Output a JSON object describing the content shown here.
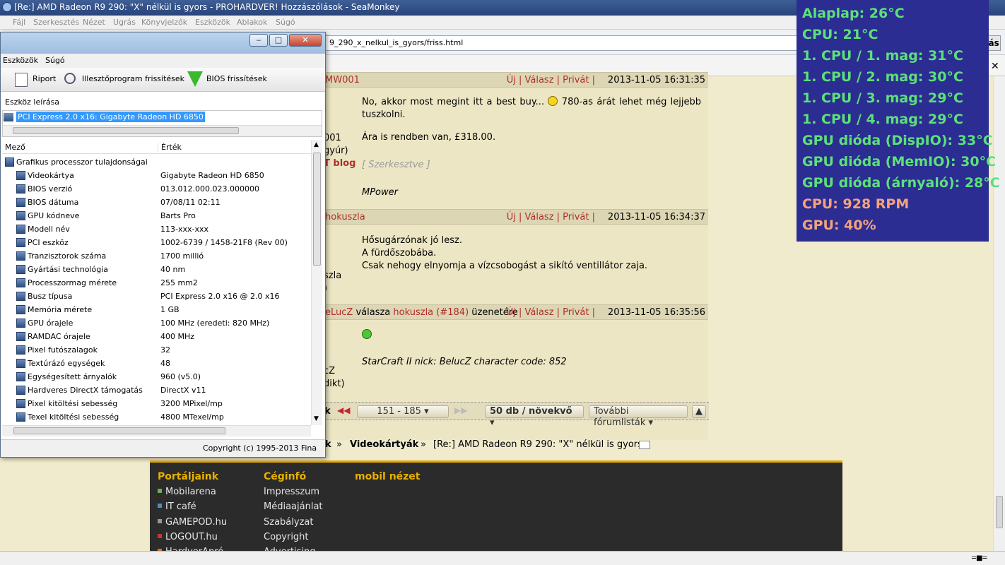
{
  "window": {
    "title": "[Re:] AMD Radeon R9 290: \"X\" nélkül is gyors - PROHARDVER! Hozzászólások - SeaMonkey",
    "menu": [
      "Fájl",
      "Szerkesztés",
      "Nézet",
      "Ugrás",
      "Könyvjelzők",
      "Eszközök",
      "Ablakok",
      "Súgó"
    ],
    "url": "9_290_x_nelkul_is_gyors/friss.html",
    "go_label": "Ugrás"
  },
  "posts": [
    {
      "user_fragment": "MW001",
      "actions": "Új | Válasz | Privát |",
      "date": "2013-11-05 16:31:35",
      "left_lines": [
        "001",
        "gyúr)",
        "T blog"
      ],
      "text": [
        "No, akkor most megint itt a best buy...",
        "780-as árát lehet még lejjebb tuszkolni.",
        "Ára is rendben van, £318.00."
      ],
      "edited": "[ Szerkesztve ]",
      "signature": "MPower"
    },
    {
      "user_fragment": "hokuszla",
      "actions": "Új | Válasz | Privát |",
      "date": "2013-11-05 16:34:37",
      "left_lines": [
        "szla",
        ")"
      ],
      "text": [
        "Hősugárzónak jó lesz.",
        "A fürdőszobába.",
        "Csak nehogy elnyomja a vízcsobogást a sikító ventillátor zaja."
      ]
    },
    {
      "user_fragment": "eLucZ",
      "reply_word": "válasza",
      "reply_to": "hokuszla",
      "reply_num": "(#184)",
      "reply_suffix": "üzenetére",
      "actions": "Új | Válasz | Privát |",
      "date": "2013-11-05 16:35:56",
      "left_lines": [
        "cZ",
        "dikt)"
      ],
      "signature": "StarCraft II nick: BelucZ character code: 852"
    }
  ],
  "pager": {
    "range": "151 - 185",
    "per_page": "50 db / növekvő",
    "more": "További fórumlisták",
    "left_fragment": "k"
  },
  "breadcrumb": {
    "prefix": "k",
    "sep": "»",
    "category": "Videokártyák",
    "topic": "[Re:] AMD Radeon R9 290: \"X\" nélkül is gyors"
  },
  "footer": {
    "col1_title": "Portáljaink",
    "col1": [
      {
        "label": "Mobilarena",
        "color": "#6ab04c"
      },
      {
        "label": "IT café",
        "color": "#4a90c2"
      },
      {
        "label": "GAMEPOD.hu",
        "color": "#999999"
      },
      {
        "label": "LOGOUT.hu",
        "color": "#cc3333"
      },
      {
        "label": "HardverApró",
        "color": "#e07020"
      }
    ],
    "col2_title": "Céginfó",
    "col2": [
      "Impresszum",
      "Médiaajánlat",
      "Szabályzat",
      "Copyright",
      "Advertising"
    ],
    "col3_title": "mobil nézet"
  },
  "tool": {
    "menu": [
      "Eszközök",
      "Súgó"
    ],
    "toolbar": [
      "Riport",
      "Illesztőprogram frissítések",
      "BIOS frissítések"
    ],
    "device_label": "Eszköz leírása",
    "device": "PCI Express 2.0 x16: Gigabyte Radeon HD 6850",
    "col_field": "Mező",
    "col_value": "Érték",
    "group": "Grafikus processzor tulajdonságai",
    "rows": [
      {
        "f": "Videokártya",
        "v": "Gigabyte Radeon HD 6850"
      },
      {
        "f": "BIOS verzió",
        "v": "013.012.000.023.000000"
      },
      {
        "f": "BIOS dátuma",
        "v": "07/08/11 02:11"
      },
      {
        "f": "GPU kódneve",
        "v": "Barts Pro"
      },
      {
        "f": "Modell név",
        "v": "113-xxx-xxx"
      },
      {
        "f": "PCI eszköz",
        "v": "1002-6739 / 1458-21F8  (Rev 00)"
      },
      {
        "f": "Tranzisztorok száma",
        "v": "1700 millió"
      },
      {
        "f": "Gyártási technológia",
        "v": "40 nm"
      },
      {
        "f": "Processzormag mérete",
        "v": "255 mm2"
      },
      {
        "f": "Busz típusa",
        "v": "PCI Express 2.0 x16 @ 2.0 x16"
      },
      {
        "f": "Memória mérete",
        "v": "1 GB"
      },
      {
        "f": "GPU órajele",
        "v": "100 MHz  (eredeti: 820 MHz)"
      },
      {
        "f": "RAMDAC órajele",
        "v": "400 MHz"
      },
      {
        "f": "Pixel futószalagok",
        "v": "32"
      },
      {
        "f": "Textúrázó egységek",
        "v": "48"
      },
      {
        "f": "Egységesített árnyalók",
        "v": "960  (v5.0)"
      },
      {
        "f": "Hardveres DirectX támogatás",
        "v": "DirectX v11"
      },
      {
        "f": "Pixel kitöltési sebesség",
        "v": "3200 MPixel/mp"
      },
      {
        "f": "Texel kitöltési sebesség",
        "v": "4800 MTexel/mp"
      }
    ],
    "status": "Copyright (c) 1995-2013 Fina"
  },
  "osd": [
    {
      "text": "Alaplap: 26°C",
      "color": "#5de07a"
    },
    {
      "text": "CPU: 21°C",
      "color": "#5de07a"
    },
    {
      "text": "1. CPU / 1. mag: 31°C",
      "color": "#5de07a"
    },
    {
      "text": "1. CPU / 2. mag: 30°C",
      "color": "#5de07a"
    },
    {
      "text": "1. CPU / 3. mag: 29°C",
      "color": "#5de07a"
    },
    {
      "text": "1. CPU / 4. mag: 29°C",
      "color": "#5de07a"
    },
    {
      "text": "GPU dióda (DispIO): 33°C",
      "color": "#5de07a"
    },
    {
      "text": "GPU dióda (MemIO): 30°C",
      "color": "#5de07a"
    },
    {
      "text": "GPU dióda (árnyaló): 28°C",
      "color": "#5de07a"
    },
    {
      "text": "CPU: 928 RPM",
      "color": "#f4a27c"
    },
    {
      "text": "GPU: 40%",
      "color": "#f4a27c"
    }
  ]
}
